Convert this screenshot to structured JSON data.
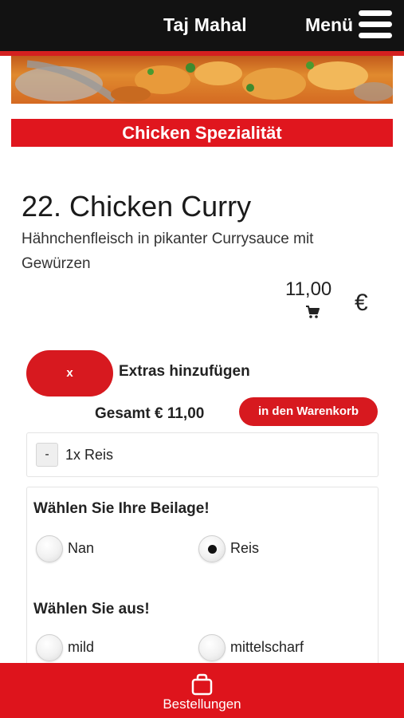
{
  "header": {
    "title": "Taj Mahal",
    "menu_label": "Menü",
    "menu_icon": "hamburger-icon"
  },
  "banner": {
    "image": "chicken-curry-food-photo"
  },
  "category": {
    "title": "Chicken Spezialität"
  },
  "dish": {
    "title": "22. Chicken Curry",
    "description": "Hähnchenfleisch in pikanter Currysauce mit Gewürzen",
    "price": "11,00",
    "currency": "€",
    "cart_icon": "cart-icon"
  },
  "extras": {
    "toggle_label": "x",
    "label": "Extras hinzufügen"
  },
  "order": {
    "total_label": "Gesamt € 11,00",
    "add_to_cart_label": "in den Warenkorb"
  },
  "selected": {
    "minus_label": "-",
    "item": "1x Reis"
  },
  "options": {
    "side": {
      "title": "Wählen Sie Ihre Beilage!",
      "choices": [
        {
          "label": "Nan",
          "checked": false
        },
        {
          "label": "Reis",
          "checked": true
        }
      ]
    },
    "spice": {
      "title": "Wählen Sie aus!",
      "choices": [
        {
          "label": "mild",
          "checked": false
        },
        {
          "label": "mittelscharf",
          "checked": false
        }
      ]
    }
  },
  "bottom_nav": {
    "label": "Bestellungen",
    "icon": "shopping-bag-icon"
  },
  "colors": {
    "accent": "#de141c",
    "topbar": "#121212"
  }
}
